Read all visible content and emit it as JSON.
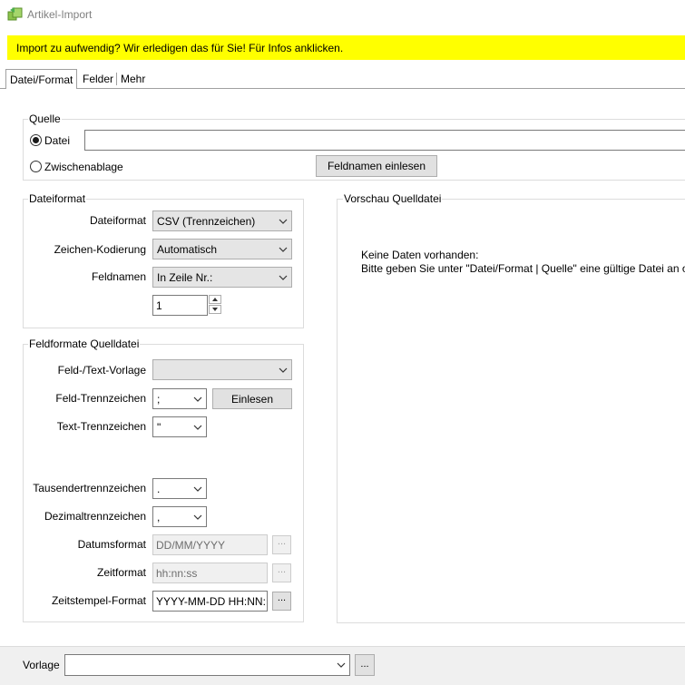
{
  "window": {
    "title": "Artikel-Import"
  },
  "banner": {
    "text": "Import zu aufwendig? Wir erledigen das für Sie! Für Infos anklicken."
  },
  "tabs": [
    {
      "label": "Datei/Format",
      "active": true
    },
    {
      "label": "Felder",
      "active": false
    },
    {
      "label": "Mehr",
      "active": false
    }
  ],
  "quelle": {
    "legend": "Quelle",
    "datei_label": "Datei",
    "datei_selected": true,
    "datei_path": "",
    "zwischenablage_label": "Zwischenablage",
    "zwischenablage_selected": false,
    "feldnamen_button": "Feldnamen einlesen"
  },
  "dateiformat": {
    "legend": "Dateiformat",
    "dateiformat_label": "Dateiformat",
    "dateiformat_value": "CSV (Trennzeichen)",
    "kodierung_label": "Zeichen-Kodierung",
    "kodierung_value": "Automatisch",
    "feldnamen_label": "Feldnamen",
    "feldnamen_value": "In Zeile Nr.:",
    "zeile_nr": "1"
  },
  "feldformate": {
    "legend": "Feldformate Quelldatei",
    "vorlage_label": "Feld-/Text-Vorlage",
    "vorlage_value": "",
    "feld_trenn_label": "Feld-Trennzeichen",
    "feld_trenn_value": ";",
    "einlesen_button": "Einlesen",
    "text_trenn_label": "Text-Trennzeichen",
    "text_trenn_value": "\"",
    "tausender_label": "Tausendertrennzeichen",
    "tausender_value": ".",
    "dezimal_label": "Dezimaltrennzeichen",
    "dezimal_value": ",",
    "datum_label": "Datumsformat",
    "datum_value": "DD/MM/YYYY",
    "zeit_label": "Zeitformat",
    "zeit_value": "hh:nn:ss",
    "zeitstempel_label": "Zeitstempel-Format",
    "zeitstempel_value": "YYYY-MM-DD HH:NN:SS",
    "dots": "..."
  },
  "vorschau": {
    "legend": "Vorschau Quelldatei",
    "line1": "Keine Daten vorhanden:",
    "line2": "Bitte geben Sie unter \"Datei/Format | Quelle\" eine gültige Datei an oder"
  },
  "footer": {
    "vorlage_label": "Vorlage",
    "vorlage_value": "",
    "dots": "..."
  },
  "icons": {
    "app": "import-icon",
    "dropdown": "chevron-down-icon"
  },
  "colors": {
    "banner": "#ffff00",
    "title_text": "#808080"
  }
}
